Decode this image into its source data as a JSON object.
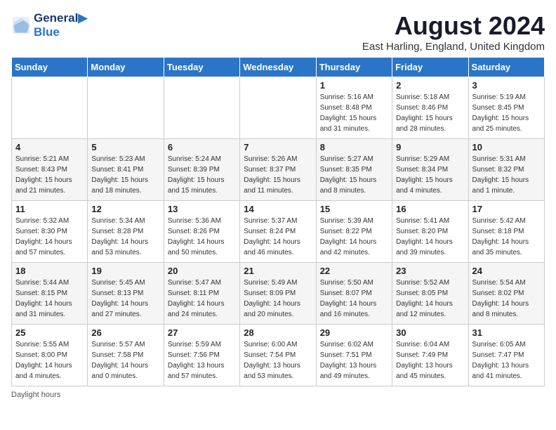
{
  "logo": {
    "line1": "General",
    "line2": "Blue"
  },
  "title": "August 2024",
  "location": "East Harling, England, United Kingdom",
  "headers": [
    "Sunday",
    "Monday",
    "Tuesday",
    "Wednesday",
    "Thursday",
    "Friday",
    "Saturday"
  ],
  "footer": "Daylight hours",
  "weeks": [
    [
      {
        "num": "",
        "sunrise": "",
        "sunset": "",
        "daylight": ""
      },
      {
        "num": "",
        "sunrise": "",
        "sunset": "",
        "daylight": ""
      },
      {
        "num": "",
        "sunrise": "",
        "sunset": "",
        "daylight": ""
      },
      {
        "num": "",
        "sunrise": "",
        "sunset": "",
        "daylight": ""
      },
      {
        "num": "1",
        "sunrise": "Sunrise: 5:16 AM",
        "sunset": "Sunset: 8:48 PM",
        "daylight": "Daylight: 15 hours and 31 minutes."
      },
      {
        "num": "2",
        "sunrise": "Sunrise: 5:18 AM",
        "sunset": "Sunset: 8:46 PM",
        "daylight": "Daylight: 15 hours and 28 minutes."
      },
      {
        "num": "3",
        "sunrise": "Sunrise: 5:19 AM",
        "sunset": "Sunset: 8:45 PM",
        "daylight": "Daylight: 15 hours and 25 minutes."
      }
    ],
    [
      {
        "num": "4",
        "sunrise": "Sunrise: 5:21 AM",
        "sunset": "Sunset: 8:43 PM",
        "daylight": "Daylight: 15 hours and 21 minutes."
      },
      {
        "num": "5",
        "sunrise": "Sunrise: 5:23 AM",
        "sunset": "Sunset: 8:41 PM",
        "daylight": "Daylight: 15 hours and 18 minutes."
      },
      {
        "num": "6",
        "sunrise": "Sunrise: 5:24 AM",
        "sunset": "Sunset: 8:39 PM",
        "daylight": "Daylight: 15 hours and 15 minutes."
      },
      {
        "num": "7",
        "sunrise": "Sunrise: 5:26 AM",
        "sunset": "Sunset: 8:37 PM",
        "daylight": "Daylight: 15 hours and 11 minutes."
      },
      {
        "num": "8",
        "sunrise": "Sunrise: 5:27 AM",
        "sunset": "Sunset: 8:35 PM",
        "daylight": "Daylight: 15 hours and 8 minutes."
      },
      {
        "num": "9",
        "sunrise": "Sunrise: 5:29 AM",
        "sunset": "Sunset: 8:34 PM",
        "daylight": "Daylight: 15 hours and 4 minutes."
      },
      {
        "num": "10",
        "sunrise": "Sunrise: 5:31 AM",
        "sunset": "Sunset: 8:32 PM",
        "daylight": "Daylight: 15 hours and 1 minute."
      }
    ],
    [
      {
        "num": "11",
        "sunrise": "Sunrise: 5:32 AM",
        "sunset": "Sunset: 8:30 PM",
        "daylight": "Daylight: 14 hours and 57 minutes."
      },
      {
        "num": "12",
        "sunrise": "Sunrise: 5:34 AM",
        "sunset": "Sunset: 8:28 PM",
        "daylight": "Daylight: 14 hours and 53 minutes."
      },
      {
        "num": "13",
        "sunrise": "Sunrise: 5:36 AM",
        "sunset": "Sunset: 8:26 PM",
        "daylight": "Daylight: 14 hours and 50 minutes."
      },
      {
        "num": "14",
        "sunrise": "Sunrise: 5:37 AM",
        "sunset": "Sunset: 8:24 PM",
        "daylight": "Daylight: 14 hours and 46 minutes."
      },
      {
        "num": "15",
        "sunrise": "Sunrise: 5:39 AM",
        "sunset": "Sunset: 8:22 PM",
        "daylight": "Daylight: 14 hours and 42 minutes."
      },
      {
        "num": "16",
        "sunrise": "Sunrise: 5:41 AM",
        "sunset": "Sunset: 8:20 PM",
        "daylight": "Daylight: 14 hours and 39 minutes."
      },
      {
        "num": "17",
        "sunrise": "Sunrise: 5:42 AM",
        "sunset": "Sunset: 8:18 PM",
        "daylight": "Daylight: 14 hours and 35 minutes."
      }
    ],
    [
      {
        "num": "18",
        "sunrise": "Sunrise: 5:44 AM",
        "sunset": "Sunset: 8:15 PM",
        "daylight": "Daylight: 14 hours and 31 minutes."
      },
      {
        "num": "19",
        "sunrise": "Sunrise: 5:45 AM",
        "sunset": "Sunset: 8:13 PM",
        "daylight": "Daylight: 14 hours and 27 minutes."
      },
      {
        "num": "20",
        "sunrise": "Sunrise: 5:47 AM",
        "sunset": "Sunset: 8:11 PM",
        "daylight": "Daylight: 14 hours and 24 minutes."
      },
      {
        "num": "21",
        "sunrise": "Sunrise: 5:49 AM",
        "sunset": "Sunset: 8:09 PM",
        "daylight": "Daylight: 14 hours and 20 minutes."
      },
      {
        "num": "22",
        "sunrise": "Sunrise: 5:50 AM",
        "sunset": "Sunset: 8:07 PM",
        "daylight": "Daylight: 14 hours and 16 minutes."
      },
      {
        "num": "23",
        "sunrise": "Sunrise: 5:52 AM",
        "sunset": "Sunset: 8:05 PM",
        "daylight": "Daylight: 14 hours and 12 minutes."
      },
      {
        "num": "24",
        "sunrise": "Sunrise: 5:54 AM",
        "sunset": "Sunset: 8:02 PM",
        "daylight": "Daylight: 14 hours and 8 minutes."
      }
    ],
    [
      {
        "num": "25",
        "sunrise": "Sunrise: 5:55 AM",
        "sunset": "Sunset: 8:00 PM",
        "daylight": "Daylight: 14 hours and 4 minutes."
      },
      {
        "num": "26",
        "sunrise": "Sunrise: 5:57 AM",
        "sunset": "Sunset: 7:58 PM",
        "daylight": "Daylight: 14 hours and 0 minutes."
      },
      {
        "num": "27",
        "sunrise": "Sunrise: 5:59 AM",
        "sunset": "Sunset: 7:56 PM",
        "daylight": "Daylight: 13 hours and 57 minutes."
      },
      {
        "num": "28",
        "sunrise": "Sunrise: 6:00 AM",
        "sunset": "Sunset: 7:54 PM",
        "daylight": "Daylight: 13 hours and 53 minutes."
      },
      {
        "num": "29",
        "sunrise": "Sunrise: 6:02 AM",
        "sunset": "Sunset: 7:51 PM",
        "daylight": "Daylight: 13 hours and 49 minutes."
      },
      {
        "num": "30",
        "sunrise": "Sunrise: 6:04 AM",
        "sunset": "Sunset: 7:49 PM",
        "daylight": "Daylight: 13 hours and 45 minutes."
      },
      {
        "num": "31",
        "sunrise": "Sunrise: 6:05 AM",
        "sunset": "Sunset: 7:47 PM",
        "daylight": "Daylight: 13 hours and 41 minutes."
      }
    ]
  ]
}
